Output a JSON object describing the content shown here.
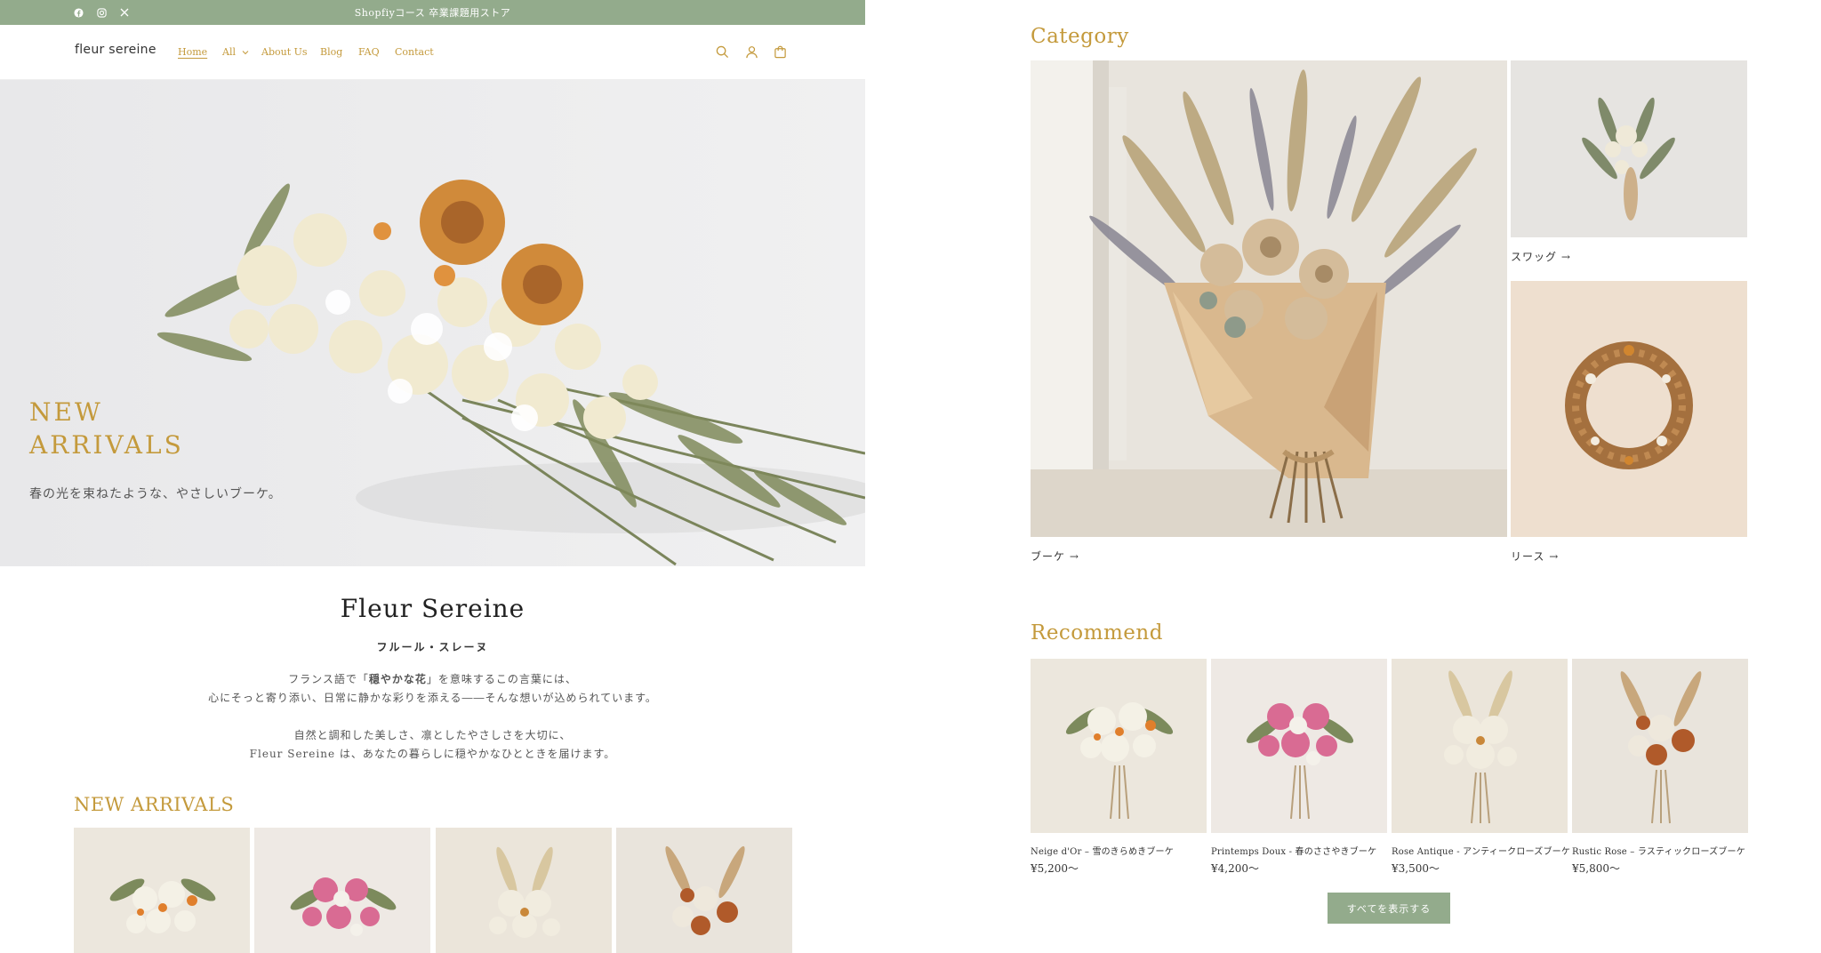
{
  "announcement": {
    "text": "Shopfiyコース 卒業課題用ストア",
    "social_icons": [
      "facebook-icon",
      "instagram-icon",
      "x-icon"
    ]
  },
  "header": {
    "logo": "fleur sereine",
    "nav": [
      {
        "label": "Home",
        "active": true
      },
      {
        "label": "All",
        "dropdown": true
      },
      {
        "label": "About Us"
      },
      {
        "label": "Blog"
      },
      {
        "label": "FAQ"
      },
      {
        "label": "Contact"
      }
    ],
    "icons": [
      "search-icon",
      "account-icon",
      "cart-icon"
    ]
  },
  "hero": {
    "title": "NEW\nARRIVALS",
    "subtitle": "春の光を束ねたような、やさしいブーケ。"
  },
  "intro": {
    "title": "Fleur Sereine",
    "subtitle": "フルール・スレーヌ",
    "para1_line1_pre": "フランス語で「",
    "para1_line1_bold": "穏やかな花",
    "para1_line1_post": "」を意味するこの言葉には、",
    "para1_line2": "心にそっと寄り添い、日常に静かな彩りを添える――そんな想いが込められています。",
    "para2_line1": "自然と調和した美しさ、凛としたやさしさを大切に、",
    "para2_line2": "Fleur Sereine は、あなたの暮らしに穏やかなひとときを届けます。"
  },
  "new_arrivals": {
    "heading": "NEW ARRIVALS"
  },
  "category": {
    "heading": "Category",
    "items": [
      {
        "label": "ブーケ"
      },
      {
        "label": "スワッグ"
      },
      {
        "label": "リース"
      }
    ]
  },
  "recommend": {
    "heading": "Recommend",
    "products": [
      {
        "name": "Neige d'Or – 雪のきらめきブーケ",
        "price": "¥5,200～"
      },
      {
        "name": "Printemps Doux - 春のささやきブーケ",
        "price": "¥4,200～"
      },
      {
        "name": "Rose Antique - アンティークローズブーケ",
        "price": "¥3,500～"
      },
      {
        "name": "Rustic Rose – ラスティックローズブーケ",
        "price": "¥5,800～"
      }
    ],
    "view_all": "すべてを表示する"
  },
  "colors": {
    "accent_gold": "#c49a3c",
    "sage_green": "#93ab8c"
  }
}
